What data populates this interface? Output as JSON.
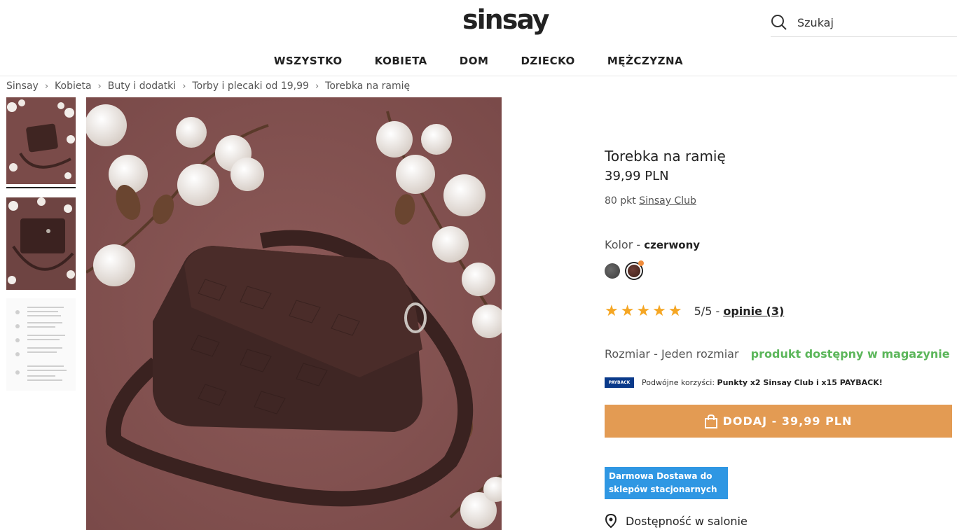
{
  "header": {
    "logo": "sinsay",
    "search_placeholder": "Szukaj"
  },
  "nav": [
    "WSZYSTKO",
    "KOBIETA",
    "DOM",
    "DZIECKO",
    "MĘŻCZYZNA"
  ],
  "breadcrumb": [
    "Sinsay",
    "Kobieta",
    "Buty i dodatki",
    "Torby i plecaki od 19,99",
    "Torebka na ramię"
  ],
  "product": {
    "title": "Torebka na ramię",
    "price": "39,99 PLN",
    "points_prefix": "80 pkt",
    "points_link": "Sinsay Club",
    "color_label": "Kolor - ",
    "color_value": "czerwony",
    "rating_stars": "★★★★★",
    "rating_value": "5/5 - ",
    "rating_link": "opinie (3)",
    "size_label": "Rozmiar - Jeden rozmiar",
    "availability": "produkt dostępny w magazynie",
    "payback_logo": "PAYBACK",
    "payback_prefix": "Podwójne korzyści: ",
    "payback_text": "Punkty x2 Sinsay Club i x15 PAYBACK!",
    "add_button": "DODAJ - 39,99 PLN",
    "delivery_badge": "Darmowa Dostawa do sklepów stacjonarnych",
    "store_availability": "Dostępność w salonie"
  },
  "colors": {
    "accent": "#e39b53",
    "available": "#5bb65a",
    "badge": "#2f97e3",
    "star": "#f5a623",
    "image_bg": "#845453"
  }
}
